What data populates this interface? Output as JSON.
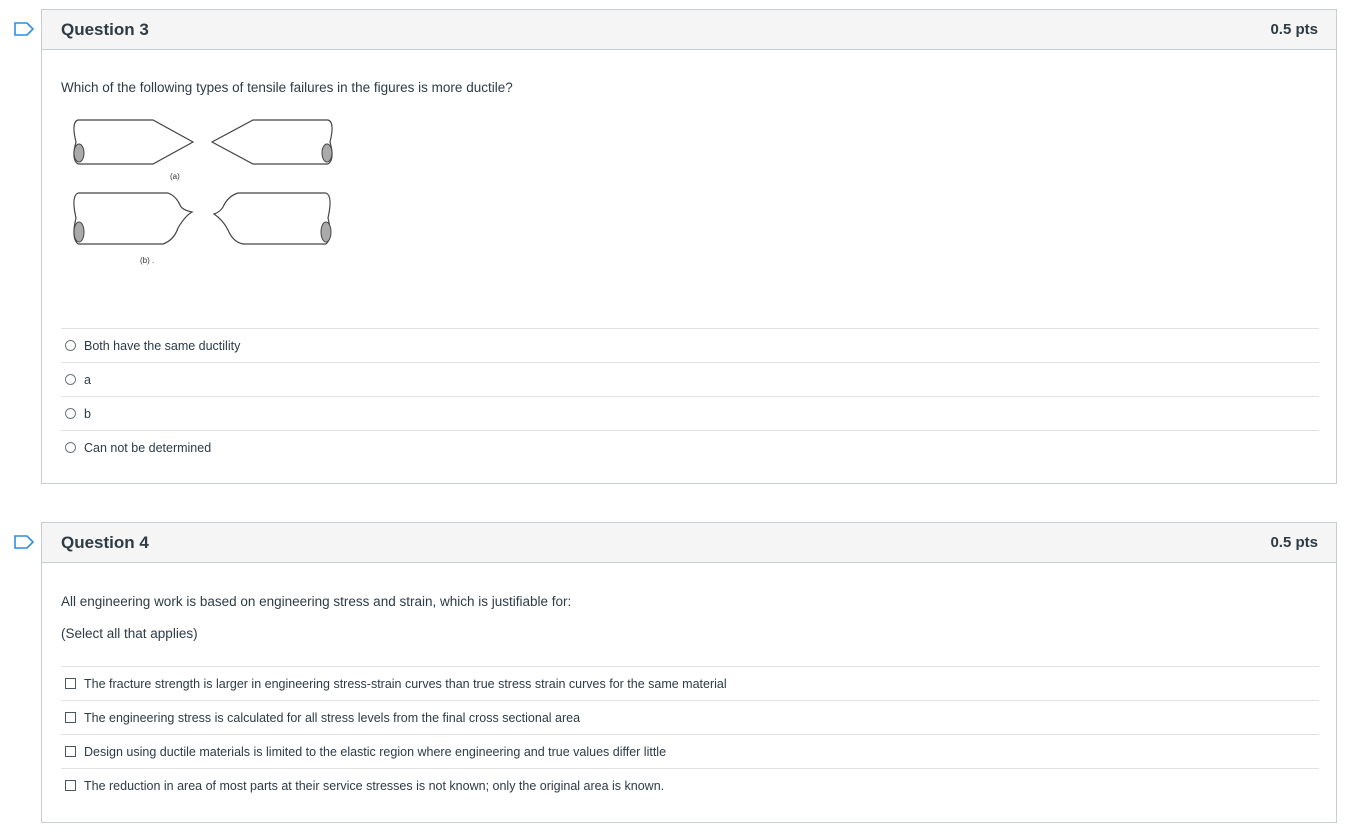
{
  "questions": [
    {
      "title": "Question 3",
      "points": "0.5 pts",
      "text": "Which of the following types of tensile failures in the figures is more ductile?",
      "figure": {
        "label_a": "(a)",
        "label_b": "(b) ."
      },
      "answers": [
        "Both have the same ductility",
        "a",
        "b",
        "Can not be determined"
      ]
    },
    {
      "title": "Question 4",
      "points": "0.5 pts",
      "text": "All engineering work is based on engineering stress and strain, which is justifiable for:",
      "subtext": "(Select all that applies)",
      "answers": [
        "The fracture strength is larger in engineering stress-strain curves than true stress strain curves for the same material",
        "The engineering stress is calculated for all stress levels from the final cross sectional area",
        "Design using ductile materials is limited to the elastic region where engineering and true values differ little",
        "The reduction in area of most parts at their service stresses is not known; only the original area is known."
      ]
    }
  ],
  "colors": {
    "flag": "#2d8de0",
    "border": "#c7cdd1",
    "header_bg": "#f5f5f5",
    "text": "#2d3b45"
  }
}
